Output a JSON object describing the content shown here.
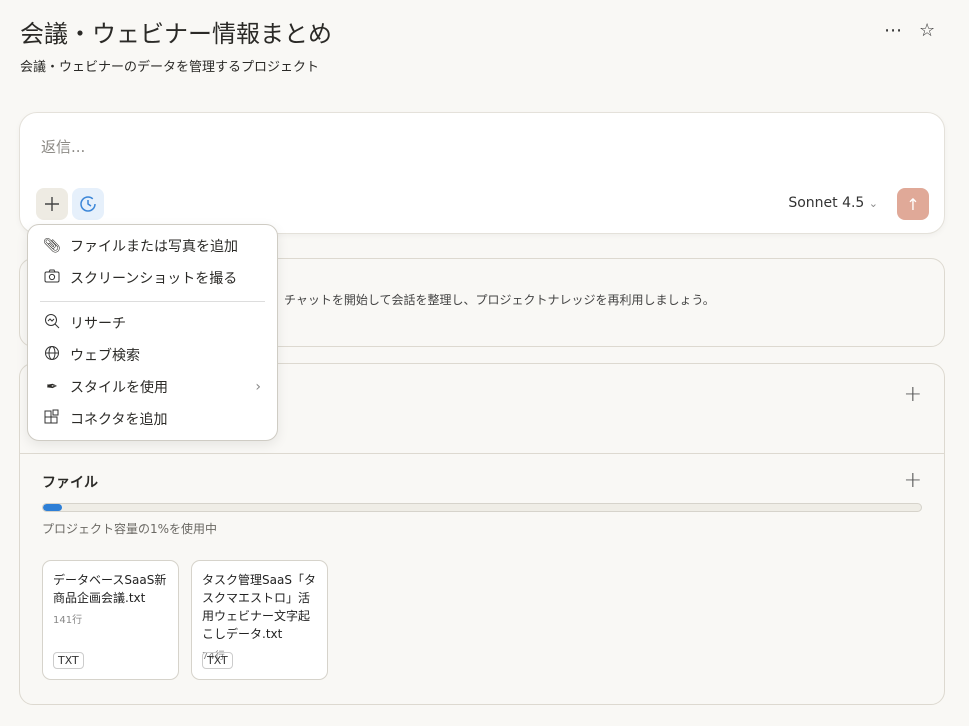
{
  "header": {
    "title": "会議・ウェビナー情報まとめ",
    "subtitle": "会議・ウェビナーのデータを管理するプロジェクト",
    "more_icon": "⋯",
    "star_icon": "☆"
  },
  "composer": {
    "placeholder": "返信...",
    "model": "Sonnet 4.5"
  },
  "menu": {
    "items": [
      {
        "label": "ファイルまたは写真を追加",
        "icon": "paperclip-icon"
      },
      {
        "label": "スクリーンショットを撮る",
        "icon": "camera-icon"
      },
      {
        "label": "リサーチ",
        "icon": "research-icon"
      },
      {
        "label": "ウェブ検索",
        "icon": "globe-icon"
      },
      {
        "label": "スタイルを使用",
        "icon": "feather-icon"
      },
      {
        "label": "コネクタを追加",
        "icon": "connector-icon"
      }
    ]
  },
  "instructions": {
    "text": "チャットを開始して会話を整理し、プロジェクトナレッジを再利用しましょう。"
  },
  "files": {
    "heading": "ファイル",
    "usage_percent": 1,
    "usage_text": "プロジェクト容量の1%を使用中",
    "items": [
      {
        "name": "データベースSaaS新商品企画会議.txt",
        "lines": "141行",
        "type": "TXT"
      },
      {
        "name": "タスク管理SaaS「タスクマエストロ」活用ウェビナー文字起こしデータ.txt",
        "lines": "74行",
        "type": "TXT"
      }
    ]
  }
}
